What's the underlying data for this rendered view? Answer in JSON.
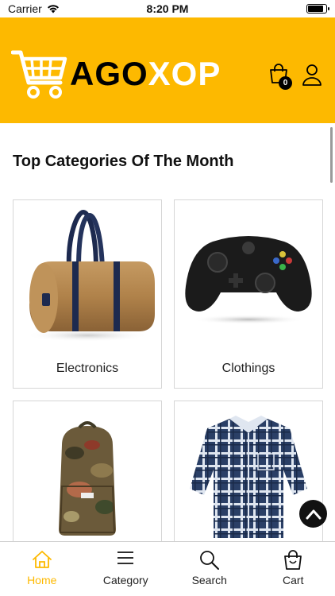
{
  "status_bar": {
    "carrier": "Carrier",
    "time": "8:20 PM",
    "battery_level": 0.9
  },
  "header": {
    "logo_text_1": "AGO",
    "logo_text_2": "XOP",
    "cart_count": "0",
    "brand_color": "#FDB900",
    "icons": [
      "shopping-cart-logo-icon",
      "shopping-bag-icon",
      "user-icon"
    ]
  },
  "main": {
    "section_title": "Top Categories Of The Month",
    "categories": [
      {
        "label": "Electronics",
        "icon": "duffel-bag-image"
      },
      {
        "label": "Clothings",
        "icon": "game-controller-image"
      },
      {
        "label": "",
        "icon": "backpack-image"
      },
      {
        "label": "",
        "icon": "plaid-shirt-image"
      }
    ]
  },
  "bottom_nav": {
    "items": [
      {
        "label": "Home",
        "icon": "home-icon",
        "active": true
      },
      {
        "label": "Category",
        "icon": "menu-icon",
        "active": false
      },
      {
        "label": "Search",
        "icon": "search-icon",
        "active": false
      },
      {
        "label": "Cart",
        "icon": "bag-icon",
        "active": false
      }
    ],
    "active_color": "#FDB900"
  }
}
